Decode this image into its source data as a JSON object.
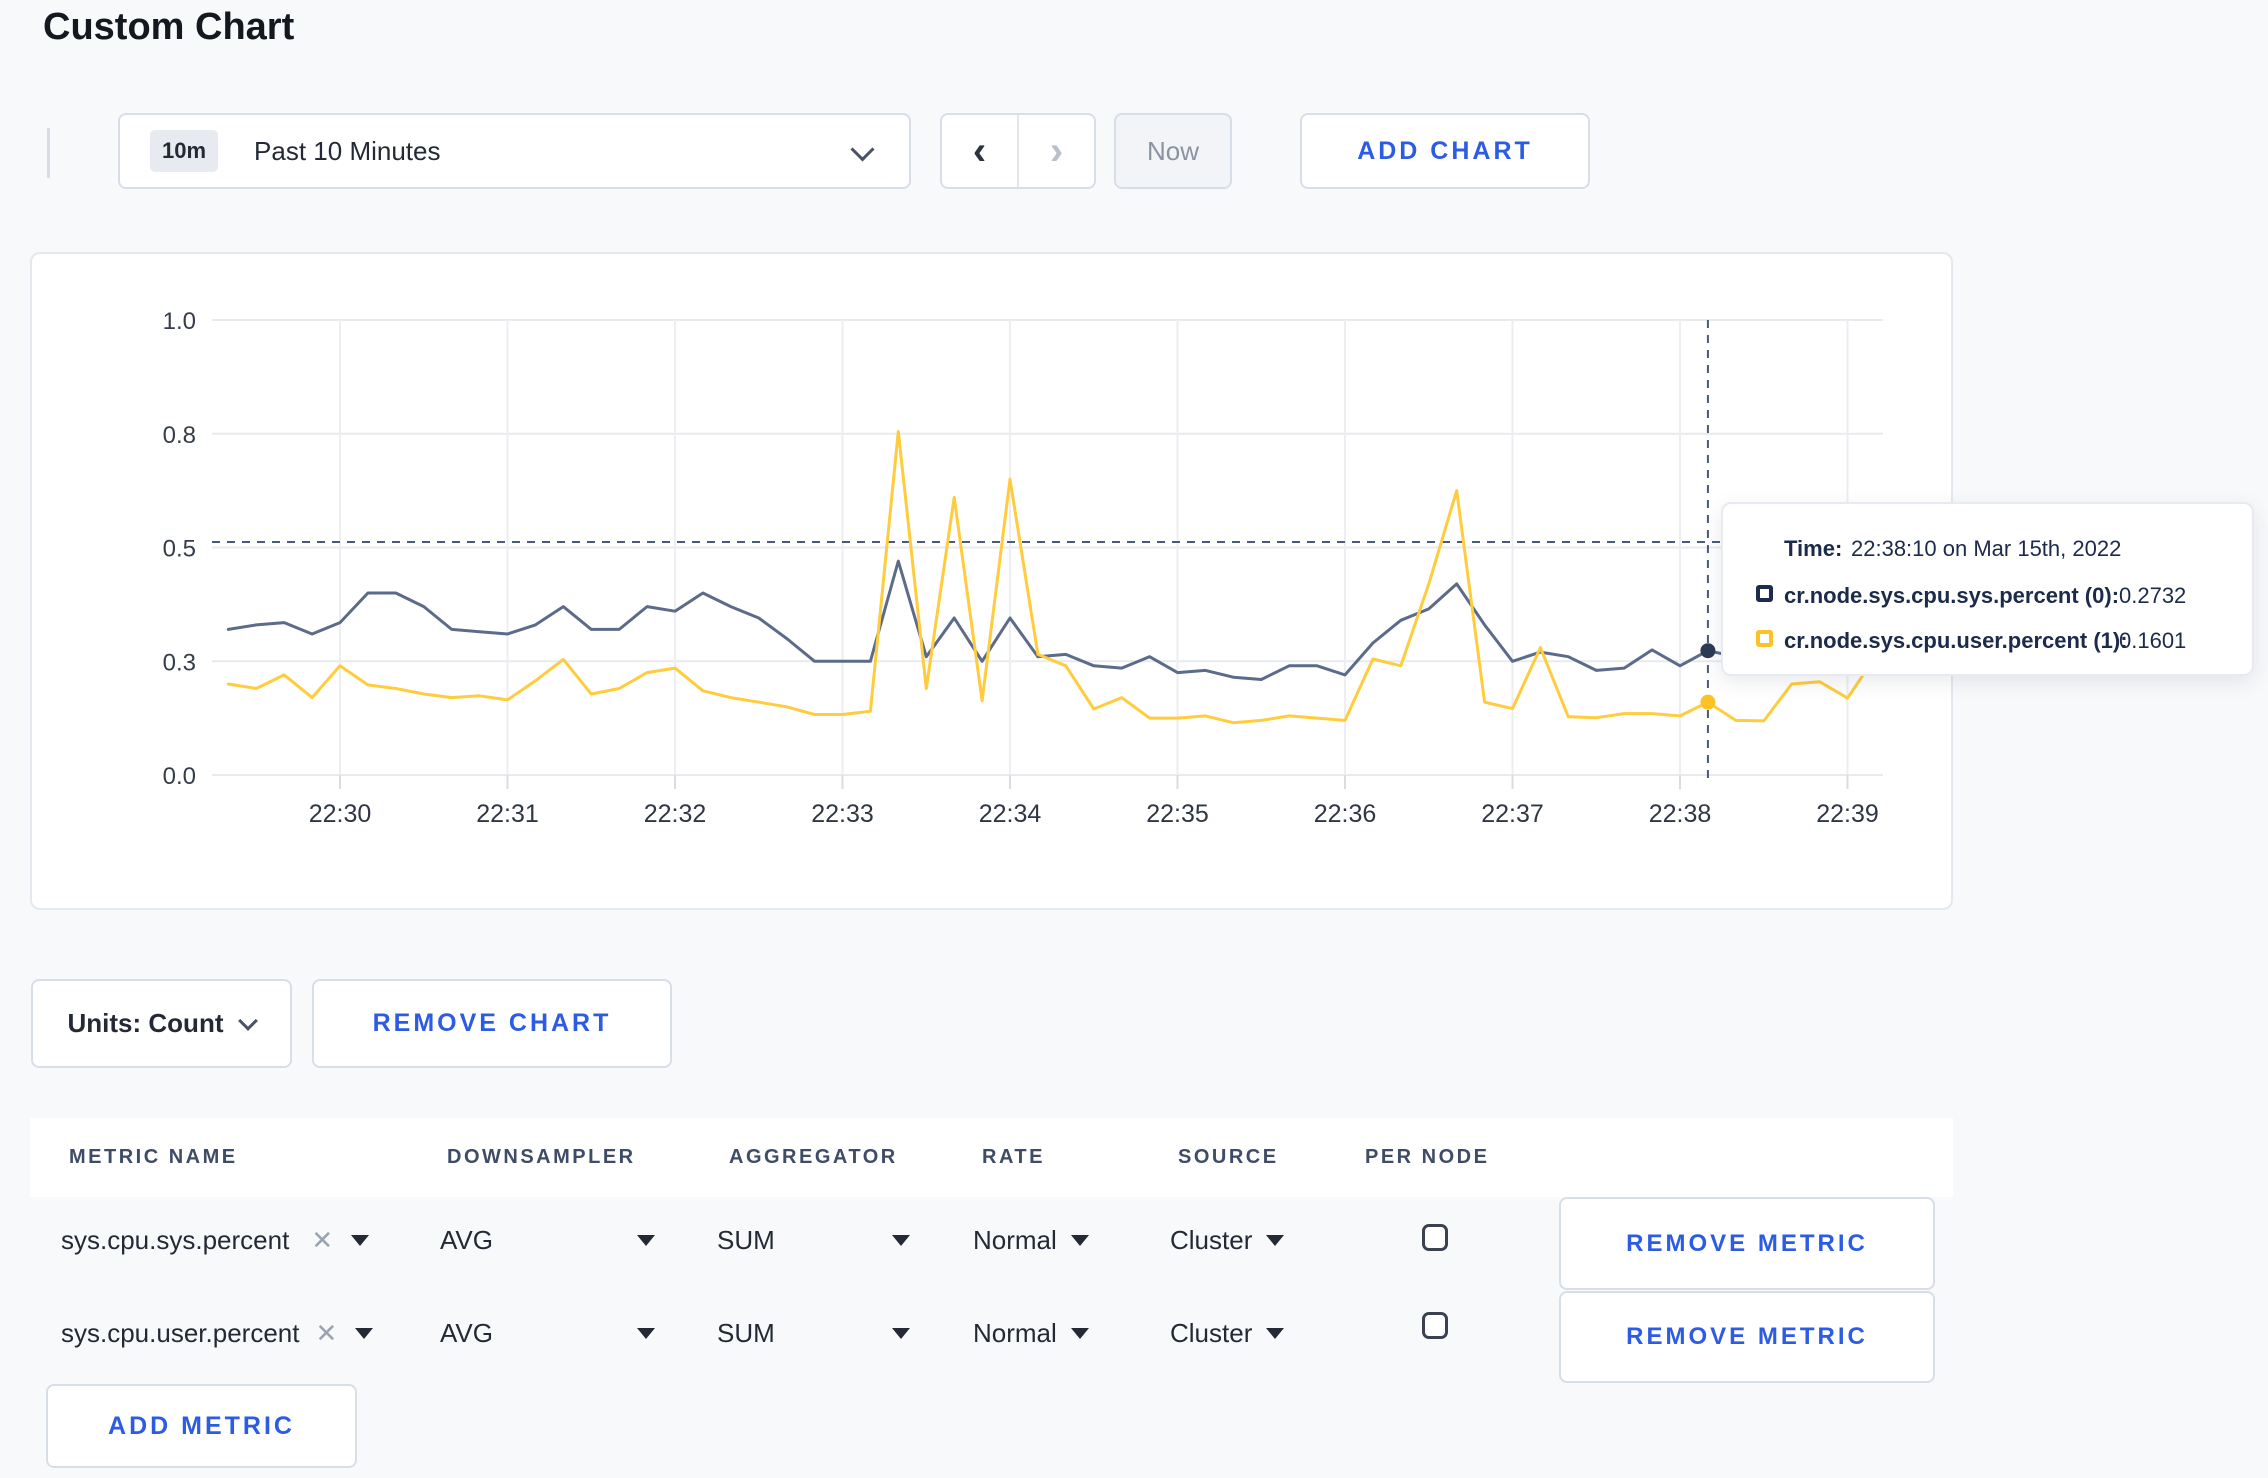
{
  "page": {
    "title": "Custom Chart"
  },
  "colors": {
    "accent_blue": "#2d5ce4",
    "navy_text": "#1c2b4a",
    "series_sys": "#5b6b89",
    "series_sys_dot": "#2c3a54",
    "series_user": "#ffcc3d",
    "crosshair": "#4a5a78"
  },
  "toolbar": {
    "range_badge": "10m",
    "range_label": "Past 10 Minutes",
    "prev_label": "‹",
    "next_label": "›",
    "now_label": "Now",
    "add_chart_label": "ADD CHART"
  },
  "tooltip": {
    "time_label": "Time:",
    "time_value": "22:38:10 on Mar 15th, 2022",
    "rows": [
      {
        "label": "cr.node.sys.cpu.sys.percent (0):",
        "value": "0.2732",
        "color": "#1d2c4e"
      },
      {
        "label": "cr.node.sys.cpu.user.percent (1):",
        "value": "0.1601",
        "color": "#ffc224"
      }
    ]
  },
  "chart_footer": {
    "units_label": "Units: Count",
    "remove_chart_label": "REMOVE CHART"
  },
  "metrics_table": {
    "headers": [
      "METRIC NAME",
      "DOWNSAMPLER",
      "AGGREGATOR",
      "RATE",
      "SOURCE",
      "PER NODE"
    ],
    "rows": [
      {
        "metric": "sys.cpu.sys.percent",
        "clear": "✕",
        "downsampler": "AVG",
        "aggregator": "SUM",
        "rate": "Normal",
        "source": "Cluster",
        "per_node_checked": false,
        "remove_label": "REMOVE METRIC"
      },
      {
        "metric": "sys.cpu.user.percent",
        "clear": "✕",
        "downsampler": "AVG",
        "aggregator": "SUM",
        "rate": "Normal",
        "source": "Cluster",
        "per_node_checked": false,
        "remove_label": "REMOVE METRIC"
      }
    ],
    "add_metric_label": "ADD METRIC"
  },
  "chart_data": {
    "type": "line",
    "title": "",
    "xlabel": "",
    "ylabel": "",
    "grid": true,
    "legend_position": "tooltip-overlay",
    "x_axis_note": "t = seconds since 22:29:00 on Mar 15th, 2022; window is Past 10 Minutes",
    "ylim": [
      0.0,
      1.0
    ],
    "y_ticks": [
      {
        "label": "0.0",
        "v": 0.0
      },
      {
        "label": "0.3",
        "v": 0.25
      },
      {
        "label": "0.5",
        "v": 0.5
      },
      {
        "label": "0.8",
        "v": 0.75
      },
      {
        "label": "1.0",
        "v": 1.0
      }
    ],
    "x_ticks": [
      {
        "label": "22:30",
        "t": 60
      },
      {
        "label": "22:31",
        "t": 120
      },
      {
        "label": "22:32",
        "t": 180
      },
      {
        "label": "22:33",
        "t": 240
      },
      {
        "label": "22:34",
        "t": 300
      },
      {
        "label": "22:35",
        "t": 360
      },
      {
        "label": "22:36",
        "t": 420
      },
      {
        "label": "22:37",
        "t": 480
      },
      {
        "label": "22:38",
        "t": 540
      },
      {
        "label": "22:39",
        "t": 600
      }
    ],
    "crosshair": {
      "t": 550,
      "time": "22:38:10",
      "y_value": 0.512
    },
    "series": [
      {
        "name": "cr.node.sys.cpu.sys.percent",
        "color": "#5b6b89",
        "dot_color": "#2c3a54",
        "hover_value": 0.2732,
        "points": [
          [
            20,
            0.32
          ],
          [
            30,
            0.33
          ],
          [
            40,
            0.335
          ],
          [
            50,
            0.31
          ],
          [
            60,
            0.335
          ],
          [
            70,
            0.4
          ],
          [
            80,
            0.4
          ],
          [
            90,
            0.37
          ],
          [
            100,
            0.32
          ],
          [
            110,
            0.315
          ],
          [
            120,
            0.31
          ],
          [
            130,
            0.33
          ],
          [
            140,
            0.37
          ],
          [
            150,
            0.32
          ],
          [
            160,
            0.32
          ],
          [
            170,
            0.37
          ],
          [
            180,
            0.36
          ],
          [
            190,
            0.4
          ],
          [
            200,
            0.37
          ],
          [
            210,
            0.345
          ],
          [
            220,
            0.3
          ],
          [
            230,
            0.25
          ],
          [
            240,
            0.25
          ],
          [
            250,
            0.25
          ],
          [
            260,
            0.47
          ],
          [
            270,
            0.26
          ],
          [
            280,
            0.345
          ],
          [
            290,
            0.25
          ],
          [
            300,
            0.345
          ],
          [
            310,
            0.26
          ],
          [
            320,
            0.265
          ],
          [
            330,
            0.24
          ],
          [
            340,
            0.235
          ],
          [
            350,
            0.26
          ],
          [
            360,
            0.225
          ],
          [
            370,
            0.23
          ],
          [
            380,
            0.215
          ],
          [
            390,
            0.21
          ],
          [
            400,
            0.24
          ],
          [
            410,
            0.24
          ],
          [
            420,
            0.22
          ],
          [
            430,
            0.29
          ],
          [
            440,
            0.34
          ],
          [
            450,
            0.365
          ],
          [
            460,
            0.42
          ],
          [
            470,
            0.33
          ],
          [
            480,
            0.25
          ],
          [
            490,
            0.27
          ],
          [
            500,
            0.26
          ],
          [
            510,
            0.23
          ],
          [
            520,
            0.235
          ],
          [
            530,
            0.275
          ],
          [
            540,
            0.24
          ],
          [
            550,
            0.2732
          ],
          [
            560,
            0.26
          ],
          [
            570,
            0.27
          ],
          [
            580,
            0.28
          ],
          [
            590,
            0.29
          ],
          [
            600,
            0.3
          ],
          [
            610,
            0.31
          ]
        ]
      },
      {
        "name": "cr.node.sys.cpu.user.percent",
        "color": "#ffcc3d",
        "dot_color": "#ffc224",
        "hover_value": 0.1601,
        "points": [
          [
            20,
            0.2
          ],
          [
            30,
            0.19
          ],
          [
            40,
            0.22
          ],
          [
            50,
            0.17
          ],
          [
            60,
            0.24
          ],
          [
            70,
            0.198
          ],
          [
            80,
            0.19
          ],
          [
            90,
            0.178
          ],
          [
            100,
            0.17
          ],
          [
            110,
            0.174
          ],
          [
            120,
            0.165
          ],
          [
            130,
            0.207
          ],
          [
            140,
            0.254
          ],
          [
            150,
            0.178
          ],
          [
            160,
            0.19
          ],
          [
            170,
            0.225
          ],
          [
            180,
            0.235
          ],
          [
            190,
            0.185
          ],
          [
            200,
            0.17
          ],
          [
            210,
            0.16
          ],
          [
            220,
            0.15
          ],
          [
            230,
            0.133
          ],
          [
            240,
            0.133
          ],
          [
            250,
            0.14
          ],
          [
            260,
            0.755
          ],
          [
            270,
            0.19
          ],
          [
            280,
            0.61
          ],
          [
            290,
            0.163
          ],
          [
            300,
            0.65
          ],
          [
            310,
            0.265
          ],
          [
            320,
            0.24
          ],
          [
            330,
            0.145
          ],
          [
            340,
            0.17
          ],
          [
            350,
            0.125
          ],
          [
            360,
            0.125
          ],
          [
            370,
            0.13
          ],
          [
            380,
            0.115
          ],
          [
            390,
            0.12
          ],
          [
            400,
            0.13
          ],
          [
            410,
            0.125
          ],
          [
            420,
            0.12
          ],
          [
            430,
            0.255
          ],
          [
            440,
            0.24
          ],
          [
            450,
            0.42
          ],
          [
            460,
            0.625
          ],
          [
            470,
            0.16
          ],
          [
            480,
            0.146
          ],
          [
            490,
            0.28
          ],
          [
            500,
            0.128
          ],
          [
            510,
            0.126
          ],
          [
            520,
            0.135
          ],
          [
            530,
            0.135
          ],
          [
            540,
            0.13
          ],
          [
            550,
            0.1601
          ],
          [
            560,
            0.12
          ],
          [
            570,
            0.119
          ],
          [
            580,
            0.2
          ],
          [
            590,
            0.205
          ],
          [
            600,
            0.169
          ],
          [
            610,
            0.26
          ]
        ]
      }
    ]
  }
}
